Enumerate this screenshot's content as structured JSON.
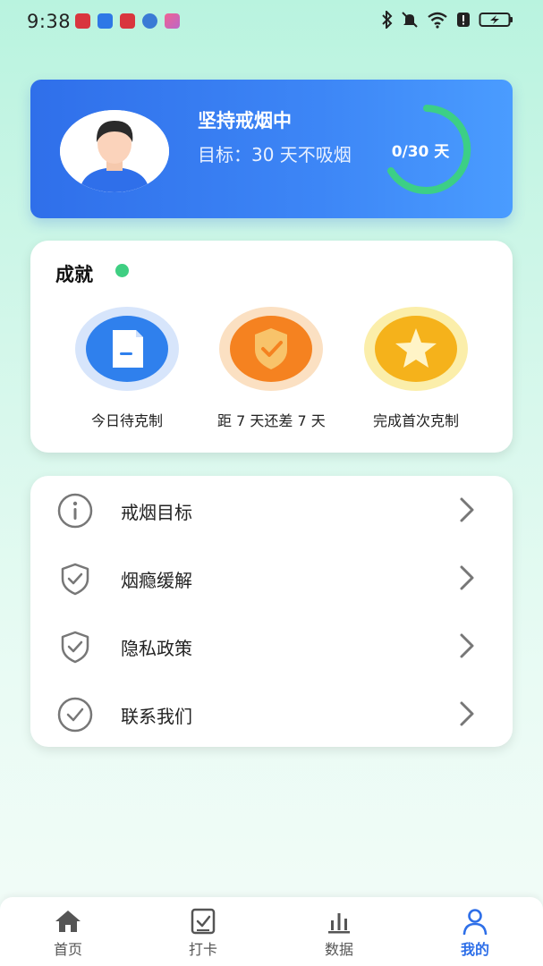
{
  "status_bar": {
    "time": "9:38",
    "battery_icon": "battery-charging-icon",
    "icons": [
      "bluetooth-icon",
      "mute-icon",
      "wifi-icon",
      "alert-icon",
      "battery-charging-icon"
    ]
  },
  "profile": {
    "title": "坚持戒烟中",
    "goal": "目标：30 天不吸烟",
    "progress_text": "0/30 天",
    "progress_value": 0,
    "progress_total": 30,
    "avatar_icon": "user-avatar-icon"
  },
  "achievements": {
    "title": "成就",
    "items": [
      {
        "label": "今日待克制",
        "icon": "document-icon",
        "color": "#2f80ed"
      },
      {
        "label": "距 7 天还差 7 天",
        "icon": "shield-check-icon",
        "color": "#f58220"
      },
      {
        "label": "完成首次克制",
        "icon": "star-icon",
        "color": "#f5b21b"
      }
    ]
  },
  "menu": {
    "items": [
      {
        "label": "戒烟目标",
        "icon": "info-icon"
      },
      {
        "label": "烟瘾缓解",
        "icon": "shield-check-icon"
      },
      {
        "label": "隐私政策",
        "icon": "shield-check-icon"
      },
      {
        "label": "联系我们",
        "icon": "check-circle-icon"
      }
    ]
  },
  "tabs": [
    {
      "label": "首页",
      "icon": "home-icon",
      "active": false
    },
    {
      "label": "打卡",
      "icon": "checkin-icon",
      "active": false
    },
    {
      "label": "数据",
      "icon": "bar-chart-icon",
      "active": false
    },
    {
      "label": "我的",
      "icon": "person-icon",
      "active": true
    }
  ],
  "colors": {
    "primary": "#2e6fe8",
    "progress_ring": "#3ccf86",
    "achievement_dot": "#3fcf82"
  }
}
